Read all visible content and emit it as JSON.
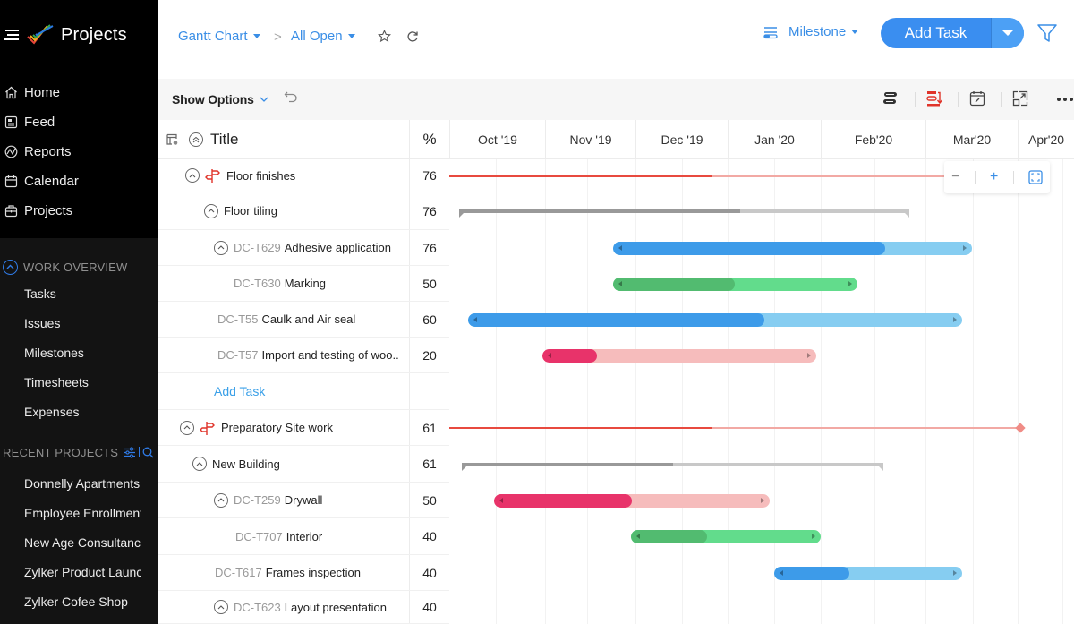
{
  "app": {
    "name": "Projects"
  },
  "sidebar": {
    "main_items": [
      {
        "label": "Home",
        "icon": "home-icon"
      },
      {
        "label": "Feed",
        "icon": "feed-icon"
      },
      {
        "label": "Reports",
        "icon": "reports-icon"
      },
      {
        "label": "Calendar",
        "icon": "calendar-icon"
      },
      {
        "label": "Projects",
        "icon": "briefcase-icon"
      }
    ],
    "work_overview": {
      "heading": "WORK OVERVIEW",
      "items": [
        "Tasks",
        "Issues",
        "Milestones",
        "Timesheets",
        "Expenses"
      ]
    },
    "recent_projects": {
      "heading": "RECENT PROJECTS",
      "items": [
        "Donnelly Apartments",
        "Employee Enrollment",
        "New Age Consultancy",
        "Zylker Product Launch",
        "Zylker Cofee Shop"
      ]
    }
  },
  "header": {
    "breadcrumb": [
      {
        "label": "Gantt Chart"
      },
      {
        "label": "All Open"
      }
    ],
    "separator": ">",
    "group_by": "Milestone",
    "add_task": "Add Task"
  },
  "toolbar": {
    "show_options": "Show Options"
  },
  "grid": {
    "title_col": "Title",
    "pct_col": "%",
    "months": [
      "Oct '19",
      "Nov '19",
      "Dec '19",
      "Jan '20",
      "Feb'20",
      "Mar'20",
      "Apr'20"
    ],
    "add_task_link": "Add Task"
  },
  "zoom_controls": {
    "minus": "−",
    "plus": "+"
  },
  "colors": {
    "accent": "#3a8ef0",
    "milestone_red": "#e84a3f",
    "blue_done": "#3d9be9",
    "blue_todo": "#86cdf1",
    "green_done": "#52bb70",
    "green_todo": "#62dc8c",
    "pink_done": "#e8336a",
    "pink_todo": "#f6bcbc",
    "group_gray": "#999999"
  },
  "chart_data": {
    "type": "gantt",
    "timeline_months": [
      "Oct '19",
      "Nov '19",
      "Dec '19",
      "Jan '20",
      "Feb'20",
      "Mar'20",
      "Apr'20"
    ],
    "rows": [
      {
        "kind": "milestone",
        "id": "",
        "name": "Floor finishes",
        "percent": 76,
        "color": "red",
        "start": 0.0,
        "end": 6.05,
        "collapsible": true
      },
      {
        "kind": "tasklist",
        "id": "",
        "name": "Floor tiling",
        "percent": 76,
        "color": "gray",
        "start": 0.1,
        "end": 4.85,
        "collapsible": true
      },
      {
        "kind": "task",
        "id": "DC-T629",
        "name": "Adhesive application",
        "percent": 76,
        "color": "blue",
        "start": 1.75,
        "end": 5.5,
        "collapsible": true
      },
      {
        "kind": "task",
        "id": "DC-T630",
        "name": "Marking",
        "percent": 50,
        "color": "green",
        "start": 1.75,
        "end": 4.35,
        "collapsible": false
      },
      {
        "kind": "task",
        "id": "DC-T55",
        "name": "Caulk and Air seal",
        "percent": 60,
        "color": "blue",
        "start": 0.2,
        "end": 5.4,
        "collapsible": false
      },
      {
        "kind": "task",
        "id": "DC-T57",
        "name": "Import and testing of woo..",
        "percent": 20,
        "color": "pink",
        "start": 0.97,
        "end": 3.95,
        "collapsible": false
      },
      {
        "kind": "add",
        "id": "",
        "name": "",
        "percent": null,
        "color": "",
        "start": null,
        "end": null,
        "collapsible": false
      },
      {
        "kind": "milestone",
        "id": "",
        "name": "Preparatory Site work",
        "percent": 61,
        "color": "red",
        "start": 0.0,
        "end": 6.05,
        "collapsible": true
      },
      {
        "kind": "tasklist",
        "id": "",
        "name": "New Building",
        "percent": 61,
        "color": "gray",
        "start": 0.13,
        "end": 4.6,
        "collapsible": true
      },
      {
        "kind": "task",
        "id": "DC-T259",
        "name": "Drywall",
        "percent": 50,
        "color": "pink",
        "start": 0.47,
        "end": 3.45,
        "collapsible": true
      },
      {
        "kind": "task",
        "id": "DC-T707",
        "name": "Interior",
        "percent": 40,
        "color": "green",
        "start": 1.95,
        "end": 4.0,
        "collapsible": false
      },
      {
        "kind": "task",
        "id": "DC-T617",
        "name": "Frames inspection",
        "percent": 40,
        "color": "blue",
        "start": 3.5,
        "end": 5.4,
        "collapsible": false
      },
      {
        "kind": "task",
        "id": "DC-T623",
        "name": "Layout presentation",
        "percent": 40,
        "color": "",
        "start": null,
        "end": null,
        "collapsible": true
      }
    ]
  }
}
